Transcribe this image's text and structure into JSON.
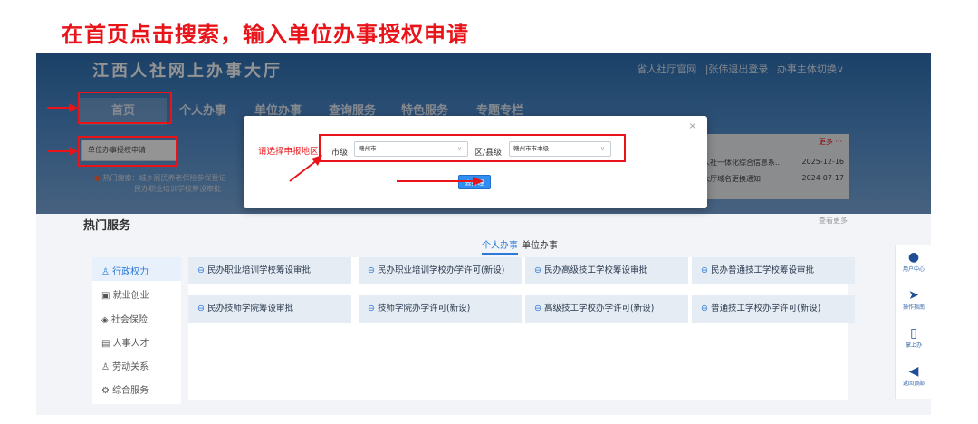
{
  "instruction": "在首页点击搜索，输入单位办事授权申请",
  "site": {
    "title": "江西人社网上办事大厅",
    "top_links": [
      "省人社厅官网",
      "|张伟退出登录",
      "办事主体切换∨"
    ]
  },
  "nav": [
    "首页",
    "个人办事",
    "单位办事",
    "查询服务",
    "特色服务",
    "专题专栏"
  ],
  "search": {
    "value": "单位办事授权申请"
  },
  "hot_search": {
    "label": "热门搜索：",
    "line1": "城乡居民养老保险参保登记",
    "line2": "民办职业培训学校筹设审批"
  },
  "news": {
    "more": "更多 ···",
    "rows": [
      {
        "title": "人社一体化综合信息系...",
        "date": "2025-12-16"
      },
      {
        "title": "大厅域名更换通知",
        "date": "2024-07-17"
      }
    ]
  },
  "hot_services": {
    "title": "热门服务",
    "see_more": "查看更多",
    "tabs": [
      "个人办事",
      "单位办事"
    ],
    "categories": [
      "行政权力",
      "就业创业",
      "社会保险",
      "人事人才",
      "劳动关系",
      "综合服务"
    ],
    "category_icons": [
      "person-icon",
      "briefcase-icon",
      "shield-icon",
      "id-card-icon",
      "people-icon",
      "gear-icon"
    ],
    "items": [
      "民办职业培训学校筹设审批",
      "民办职业培训学校办学许可(新设)",
      "民办高级技工学校筹设审批",
      "民办普通技工学校筹设审批",
      "民办技师学院筹设审批",
      "技师学院办学许可(新设)",
      "高级技工学校办学许可(新设)",
      "普通技工学校办学许可(新设)"
    ]
  },
  "side_float": [
    "用户中心",
    "操作指南",
    "掌上办",
    "返回顶部"
  ],
  "dialog": {
    "prompt": "请选择申报地区：",
    "city_label": "市级",
    "city_value": "赣州市",
    "county_label": "区/县级",
    "county_value": "赣州市市本级",
    "submit": "去办理",
    "close": "×"
  },
  "colors": {
    "highlight": "#e8141a",
    "primary": "#2f8ef0",
    "banner": "#2f70b3"
  }
}
